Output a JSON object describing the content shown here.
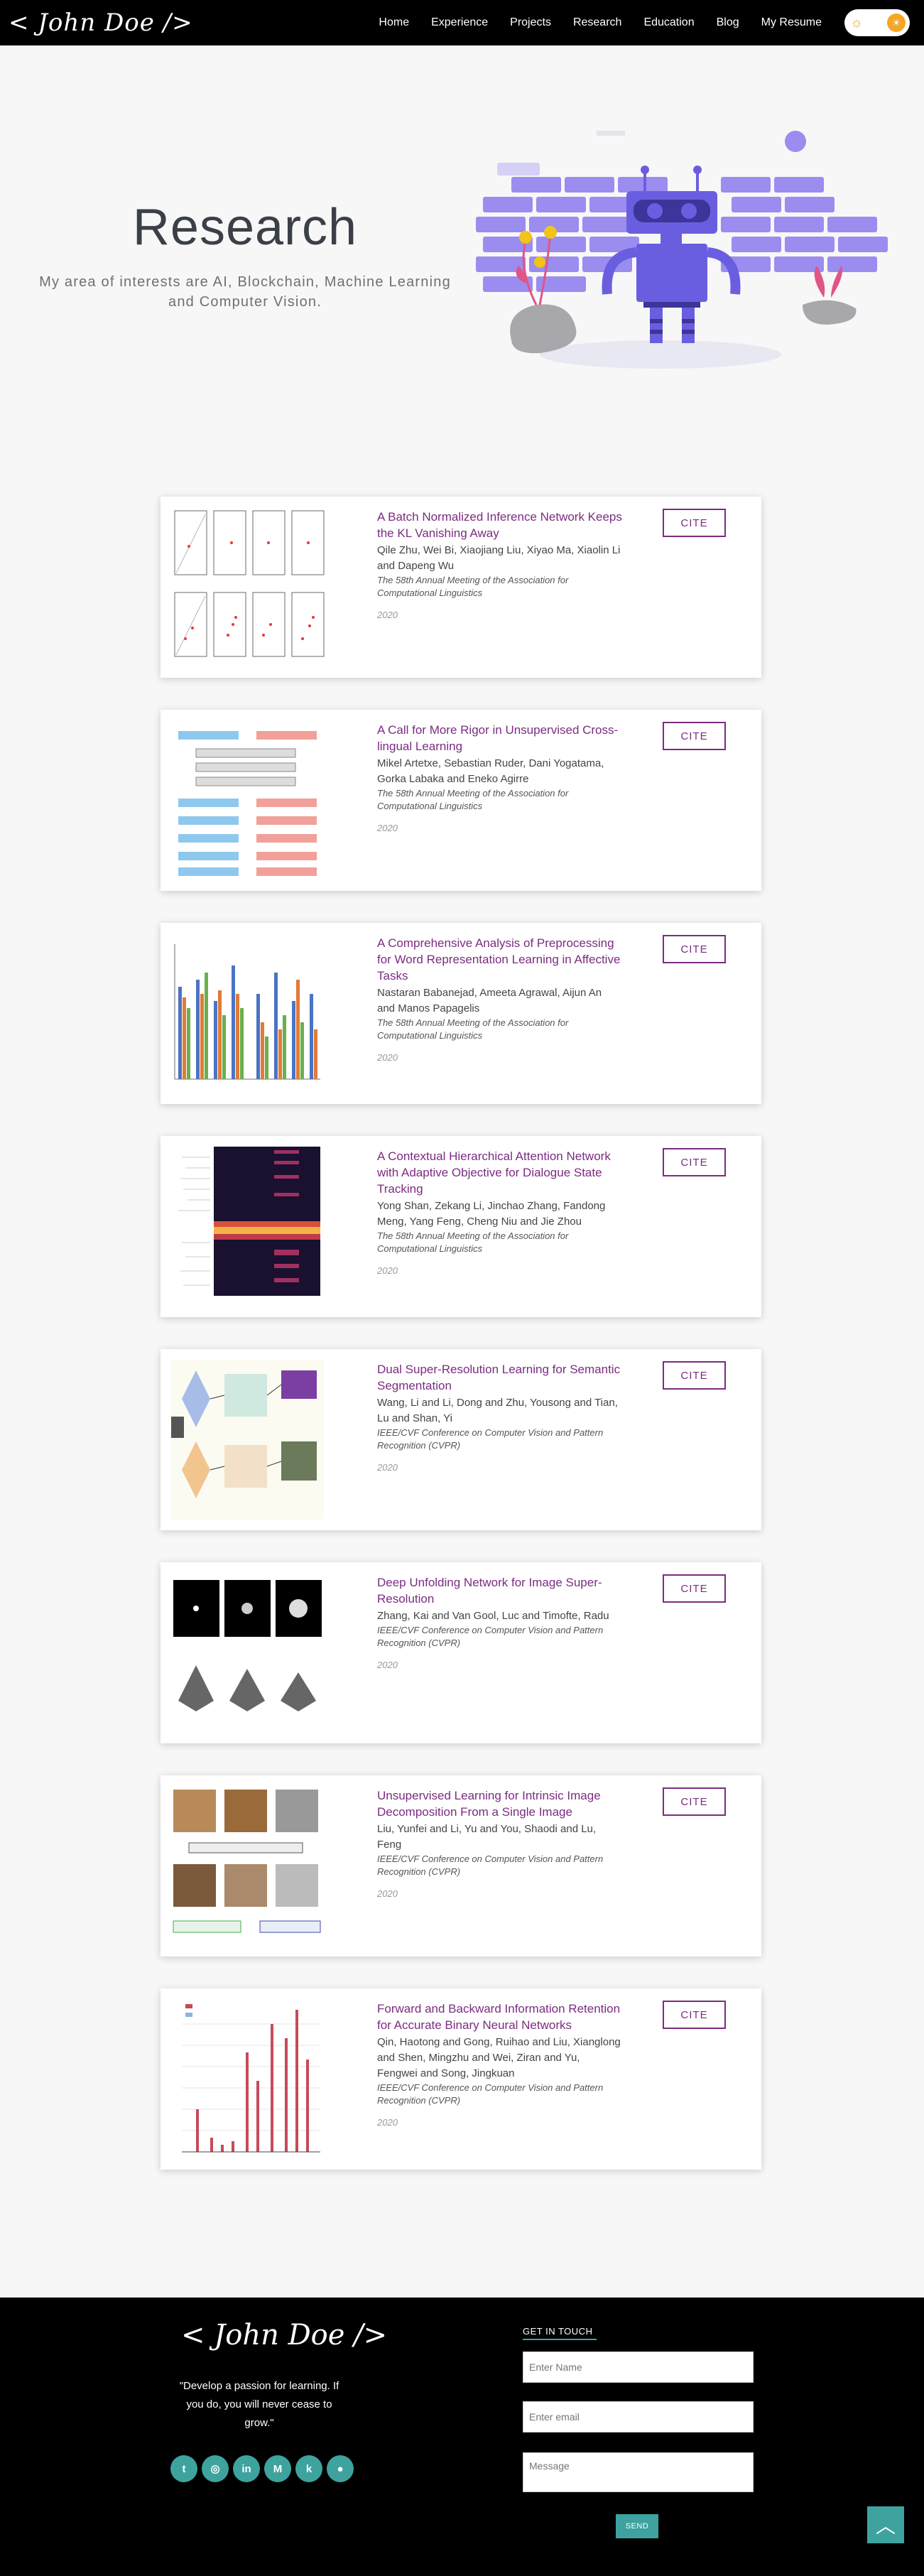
{
  "nav": {
    "logo": "< John Doe />",
    "links": [
      "Home",
      "Experience",
      "Projects",
      "Research",
      "Education",
      "Blog",
      "My Resume"
    ],
    "theme_icon": "sun-icon"
  },
  "hero": {
    "title": "Research",
    "subtitle": "My area of interests are AI, Blockchain, Machine Learning and Computer Vision.",
    "colors": {
      "accent": "#7b2c80",
      "illustration": "#9b8cf0",
      "robot": "#6a5ee0"
    }
  },
  "papers": [
    {
      "title": "A Batch Normalized Inference Network Keeps the KL Vanishing Away",
      "authors": "Qile Zhu, Wei Bi, Xiaojiang Liu, Xiyao Ma, Xiaolin Li and Dapeng Wu",
      "venue": "The 58th Annual Meeting of the Association for Computational Linguistics",
      "year": "2020",
      "cite": "CITE",
      "thumb": "scatter-grid"
    },
    {
      "title": "A Call for More Rigor in Unsupervised Cross-lingual Learning",
      "authors": "Mikel Artetxe, Sebastian Ruder, Dani Yogatama, Gorka Labaka and Eneko Agirre",
      "venue": "The 58th Annual Meeting of the Association for Computational Linguistics",
      "year": "2020",
      "cite": "CITE",
      "thumb": "layer-diagram"
    },
    {
      "title": "A Comprehensive Analysis of Preprocessing for Word Representation Learning in Affective Tasks",
      "authors": "Nastaran Babanejad, Ameeta Agrawal, Aijun An and Manos Papagelis",
      "venue": "The 58th Annual Meeting of the Association for Computational Linguistics",
      "year": "2020",
      "cite": "CITE",
      "thumb": "bar-chart"
    },
    {
      "title": "A Contextual Hierarchical Attention Network with Adaptive Objective for Dialogue State Tracking",
      "authors": "Yong Shan, Zekang Li, Jinchao Zhang, Fandong Meng, Yang Feng, Cheng Niu and Jie Zhou",
      "venue": "The 58th Annual Meeting of the Association for Computational Linguistics",
      "year": "2020",
      "cite": "CITE",
      "thumb": "heatmap"
    },
    {
      "title": "Dual Super-Resolution Learning for Semantic Segmentation",
      "authors": "Wang, Li and Li, Dong and Zhu, Yousong and Tian, Lu and Shan, Yi",
      "venue": "IEEE/CVF Conference on Computer Vision and Pattern Recognition (CVPR)",
      "year": "2020",
      "cite": "CITE",
      "thumb": "network-diagram"
    },
    {
      "title": "Deep Unfolding Network for Image Super-Resolution",
      "authors": "Zhang, Kai and Van Gool, Luc and Timofte, Radu",
      "venue": "IEEE/CVF Conference on Computer Vision and Pattern Recognition (CVPR)",
      "year": "2020",
      "cite": "CITE",
      "thumb": "kernel-plots"
    },
    {
      "title": "Unsupervised Learning for Intrinsic Image Decomposition From a Single Image",
      "authors": "Liu, Yunfei and Li, Yu and You, Shaodi and Lu, Feng",
      "venue": "IEEE/CVF Conference on Computer Vision and Pattern Recognition (CVPR)",
      "year": "2020",
      "cite": "CITE",
      "thumb": "image-grid"
    },
    {
      "title": "Forward and Backward Information Retention for Accurate Binary Neural Networks",
      "authors": "Qin, Haotong and Gong, Ruihao and Liu, Xianglong and Shen, Mingzhu and Wei, Ziran and Yu, Fengwei and Song, Jingkuan",
      "venue": "IEEE/CVF Conference on Computer Vision and Pattern Recognition (CVPR)",
      "year": "2020",
      "cite": "CITE",
      "thumb": "bar-chart-red"
    }
  ],
  "footer": {
    "logo": "< John Doe />",
    "quote": "\"Develop a passion for learning. If you do, you will never cease to grow.\"",
    "socials": [
      "twitter-icon",
      "dribbble-icon",
      "linkedin-icon",
      "medium-icon",
      "kaggle-icon",
      "github-icon"
    ],
    "get_in_touch": "GET IN TOUCH",
    "name_placeholder": "Enter Name",
    "email_placeholder": "Enter email",
    "message_placeholder": "Message",
    "send": "SEND",
    "colors": {
      "accent": "#3ea39e"
    }
  }
}
